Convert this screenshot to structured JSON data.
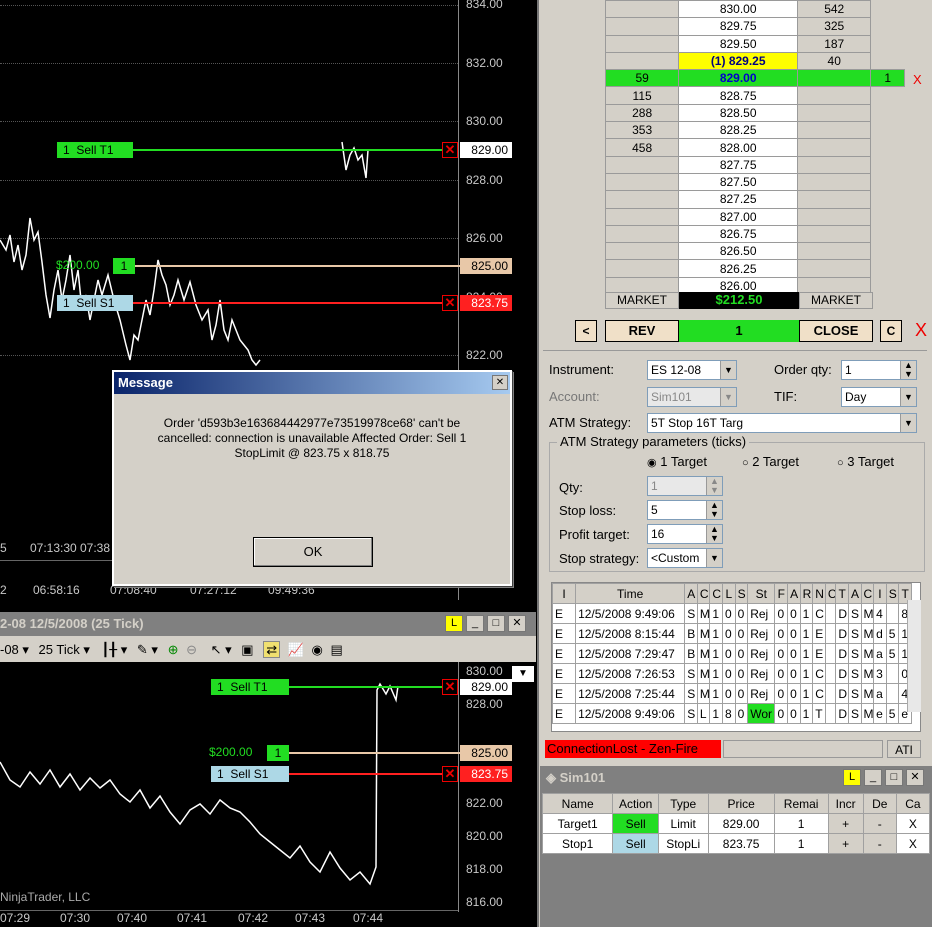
{
  "upper_chart": {
    "price_ticks": [
      "834.00",
      "832.00",
      "830.00",
      "828.00",
      "826.00",
      "822.00"
    ],
    "time_ticks_row1": [
      "5",
      "07:13:30",
      "07:38"
    ],
    "time_ticks_row2": [
      "2",
      "06:58:16",
      "07:08:40",
      "07:27:12",
      "09:49:36"
    ],
    "target_order": {
      "qty": "1",
      "label": "Sell T1",
      "price": "829.00"
    },
    "pnl_label": "$200.00",
    "pnl_qty": "1",
    "position_price": "825.00",
    "stop_order": {
      "qty": "1",
      "label": "Sell S1",
      "price": "823.75"
    },
    "hidden_tick": "824.00"
  },
  "lower_window": {
    "title": "2-08  12/5/2008 (25 Tick)",
    "link_badge": "L",
    "toolbar": {
      "instrument": "-08",
      "interval": "25 Tick"
    },
    "price_ticks": [
      "830.00",
      "828.00",
      "822.00",
      "820.00",
      "818.00",
      "816.00"
    ],
    "time_ticks": [
      "07:29",
      "07:30",
      "07:40",
      "07:41",
      "07:42",
      "07:43",
      "07:44"
    ],
    "copyright": "NinjaTrader, LLC",
    "target_order": {
      "qty": "1",
      "label": "Sell T1",
      "price": "829.00"
    },
    "pnl_label": "$200.00",
    "pnl_qty": "1",
    "position_price": "825.00",
    "stop_order": {
      "qty": "1",
      "label": "Sell S1",
      "price": "823.75"
    }
  },
  "dom": {
    "rows": [
      {
        "buy": "",
        "price": "830.00",
        "sell": "542",
        "hl": ""
      },
      {
        "buy": "",
        "price": "829.75",
        "sell": "325",
        "hl": ""
      },
      {
        "buy": "",
        "price": "829.50",
        "sell": "187",
        "hl": ""
      },
      {
        "buy": "",
        "price": "(1) 829.25",
        "sell": "40",
        "hl": "ask"
      },
      {
        "buy": "59",
        "price": "829.00",
        "sell": "",
        "hl": "last"
      },
      {
        "buy": "115",
        "price": "828.75",
        "sell": "",
        "hl": ""
      },
      {
        "buy": "288",
        "price": "828.50",
        "sell": "",
        "hl": ""
      },
      {
        "buy": "353",
        "price": "828.25",
        "sell": "",
        "hl": ""
      },
      {
        "buy": "458",
        "price": "828.00",
        "sell": "",
        "hl": ""
      },
      {
        "buy": "",
        "price": "827.75",
        "sell": "",
        "hl": ""
      },
      {
        "buy": "",
        "price": "827.50",
        "sell": "",
        "hl": ""
      },
      {
        "buy": "",
        "price": "827.25",
        "sell": "",
        "hl": ""
      },
      {
        "buy": "",
        "price": "827.00",
        "sell": "",
        "hl": ""
      },
      {
        "buy": "",
        "price": "826.75",
        "sell": "",
        "hl": ""
      },
      {
        "buy": "",
        "price": "826.50",
        "sell": "",
        "hl": ""
      },
      {
        "buy": "",
        "price": "826.25",
        "sell": "",
        "hl": ""
      },
      {
        "buy": "",
        "price": "826.00",
        "sell": "",
        "hl": ""
      }
    ],
    "working_qty": "1",
    "working_x": "X",
    "market_left": "MARKET",
    "pnl": "$212.50",
    "market_right": "MARKET",
    "btn_left": "<",
    "btn_rev": "REV",
    "position_qty": "1",
    "btn_close": "CLOSE",
    "btn_c": "C",
    "btn_x": "X"
  },
  "order_form": {
    "instrument_label": "Instrument:",
    "instrument_value": "ES 12-08",
    "order_qty_label": "Order qty:",
    "order_qty_value": "1",
    "account_label": "Account:",
    "account_value": "Sim101",
    "tif_label": "TIF:",
    "tif_value": "Day",
    "atm_label": "ATM Strategy:",
    "atm_value": "5T Stop 16T Targ",
    "params_title": "ATM Strategy parameters (ticks)",
    "radio1": "1 Target",
    "radio2": "2 Target",
    "radio3": "3 Target",
    "qty_label": "Qty:",
    "qty_value": "1",
    "stop_loss_label": "Stop loss:",
    "stop_loss_value": "5",
    "profit_label": "Profit target:",
    "profit_value": "16",
    "stop_strategy_label": "Stop strategy:",
    "stop_strategy_value": "<Custom"
  },
  "orders_log": {
    "headers": [
      "I",
      "Time",
      "A",
      "C",
      "C",
      "L",
      "S",
      "St",
      "F",
      "A",
      "R",
      "N",
      "C",
      "T",
      "A",
      "C",
      "I",
      "S",
      "T"
    ],
    "rows": [
      [
        "E",
        "12/5/2008 9:49:06",
        "S",
        "M",
        "1",
        "0",
        "0",
        "Rej",
        "0",
        "0",
        "1",
        "C",
        "",
        "D",
        "S",
        "M",
        "4",
        "",
        "8"
      ],
      [
        "E",
        "12/5/2008 8:15:44",
        "B",
        "M",
        "1",
        "0",
        "0",
        "Rej",
        "0",
        "0",
        "1",
        "E",
        "",
        "D",
        "S",
        "M",
        "d",
        "5",
        "1"
      ],
      [
        "E",
        "12/5/2008 7:29:47",
        "B",
        "M",
        "1",
        "0",
        "0",
        "Rej",
        "0",
        "0",
        "1",
        "E",
        "",
        "D",
        "S",
        "M",
        "a",
        "5",
        "1"
      ],
      [
        "E",
        "12/5/2008 7:26:53",
        "S",
        "M",
        "1",
        "0",
        "0",
        "Rej",
        "0",
        "0",
        "1",
        "C",
        "",
        "D",
        "S",
        "M",
        "3",
        "",
        "0"
      ],
      [
        "E",
        "12/5/2008 7:25:44",
        "S",
        "M",
        "1",
        "0",
        "0",
        "Rej",
        "0",
        "0",
        "1",
        "C",
        "",
        "D",
        "S",
        "M",
        "a",
        "",
        "4"
      ],
      [
        "E",
        "12/5/2008 9:49:06",
        "S",
        "L",
        "1",
        "8",
        "0",
        "Wor",
        "0",
        "0",
        "1",
        "T",
        "",
        "D",
        "S",
        "M",
        "e",
        "5",
        "e"
      ]
    ]
  },
  "status_bar": {
    "connection": "ConnectionLost - Zen-Fire",
    "ati": "ATI"
  },
  "sim_window": {
    "title": "Sim101",
    "link_badge": "L",
    "headers": [
      "Name",
      "Action",
      "Type",
      "Price",
      "Remai",
      "Incr",
      "De",
      "Ca"
    ],
    "rows": [
      {
        "name": "Target1",
        "action": "Sell",
        "type": "Limit",
        "price": "829.00",
        "remain": "1",
        "incr": "+",
        "dec": "-",
        "cancel": "X",
        "action_color": "#22dd22"
      },
      {
        "name": "Stop1",
        "action": "Sell",
        "type": "StopLi",
        "price": "823.75",
        "remain": "1",
        "incr": "+",
        "dec": "-",
        "cancel": "X",
        "action_color": "#add8e6"
      }
    ]
  },
  "dialog": {
    "title": "Message",
    "text": "Order 'd593b3e163684442977e73519978ce68' can't be cancelled: connection is unavailable Affected Order: Sell 1 StopLimit @ 823.75 x 818.75",
    "ok": "OK",
    "close": "✕"
  },
  "colors": {
    "target": "#22dd22",
    "stop": "#ff2020",
    "position": "#e8c8a8",
    "stop_tag": "#add8e6"
  }
}
